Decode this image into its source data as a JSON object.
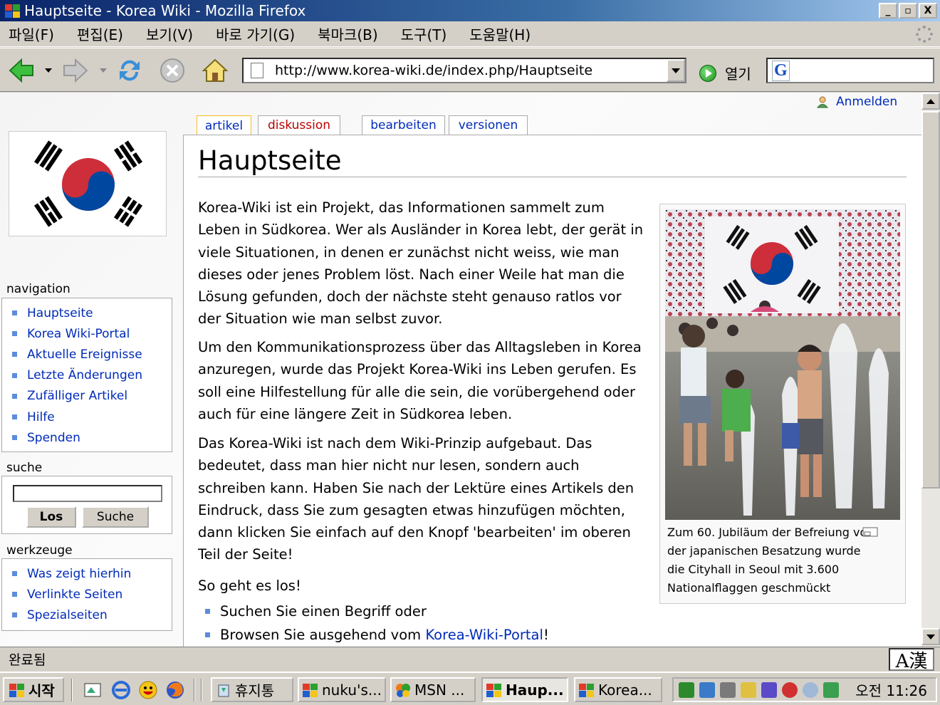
{
  "window": {
    "title": "Hauptseite - Korea Wiki - Mozilla Firefox",
    "min_label": "_",
    "max_label": "▫",
    "close_label": "X"
  },
  "menu": [
    "파일(F)",
    "편집(E)",
    "보기(V)",
    "바로 가기(G)",
    "북마크(B)",
    "도구(T)",
    "도움말(H)"
  ],
  "toolbar": {
    "url": "http://www.korea-wiki.de/index.php/Hauptseite",
    "go_label": "열기",
    "search_engine": "G"
  },
  "page": {
    "login": "Anmelden",
    "tabs": [
      "artikel",
      "diskussion",
      "bearbeiten",
      "versionen"
    ],
    "title": "Hauptseite",
    "paragraphs": [
      "Korea-Wiki ist ein Projekt, das Informationen sammelt zum Leben in Südkorea. Wer als Ausländer in Korea lebt, der gerät in viele Situationen, in denen er zunächst nicht weiss, wie man dieses oder jenes Problem löst. Nach einer Weile hat man die Lösung gefunden, doch der nächste steht genauso ratlos vor der Situation wie man selbst zuvor.",
      "Um den Kommunikationsprozess über das Alltagsleben in Korea anzuregen, wurde das Projekt Korea-Wiki ins Leben gerufen. Es soll eine Hilfestellung für alle die sein, die vorübergehend oder auch für eine längere Zeit in Südkorea leben.",
      "Das Korea-Wiki ist nach dem Wiki-Prinzip aufgebaut. Das bedeutet, dass man hier nicht nur lesen, sondern auch schreiben kann. Haben Sie nach der Lektüre eines Artikels den Eindruck, dass Sie zum gesagten etwas hinzufügen möchten, dann klicken Sie einfach auf den Knopf 'bearbeiten' im oberen Teil der Seite!",
      "So geht es los!"
    ],
    "list": [
      {
        "text": "Suchen Sie einen Begriff oder",
        "link": "",
        "suffix": ""
      },
      {
        "text": "Browsen Sie ausgehend vom ",
        "link": "Korea-Wiki-Portal",
        "suffix": "!"
      }
    ],
    "thumb_caption": "Zum 60. Jubiläum der Befreiung von der japanischen Besatzung wurde die Cityhall in Seoul mit 3.600 Nationalflaggen geschmückt"
  },
  "sidebar": {
    "navigation_title": "navigation",
    "navigation": [
      "Hauptseite",
      "Korea Wiki-Portal",
      "Aktuelle Ereignisse",
      "Letzte Änderungen",
      "Zufälliger Artikel",
      "Hilfe",
      "Spenden"
    ],
    "search_title": "suche",
    "search_go": "Los",
    "search_search": "Suche",
    "tools_title": "werkzeuge",
    "tools": [
      "Was zeigt hierhin",
      "Verlinkte Seiten",
      "Spezialseiten"
    ]
  },
  "status": {
    "text": "완료됨",
    "ime": "A漢"
  },
  "taskbar": {
    "start": "시작",
    "buttons": [
      "휴지통",
      "nuku's...",
      "MSN ...",
      "Haup...",
      "Korea..."
    ],
    "clock": "오전 11:26"
  },
  "colors": {
    "link": "#002bb8",
    "selected_tab_border": "#fabd23",
    "title_bar": "#0a246a"
  }
}
